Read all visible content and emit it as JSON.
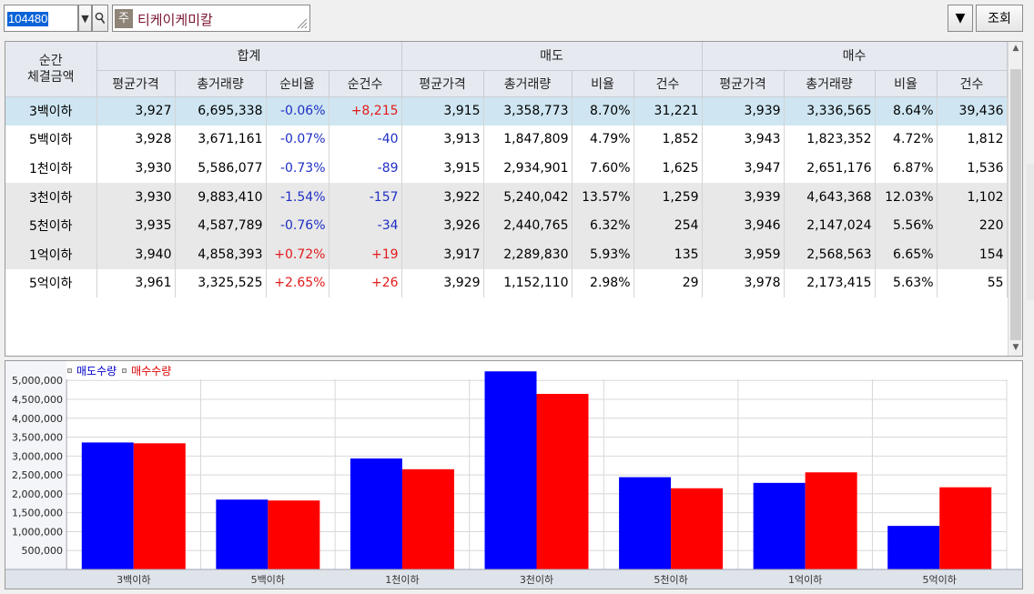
{
  "toolbar": {
    "code": "104480",
    "market_badge": "주",
    "stock_name": "티케이케미칼",
    "query_label": "조회"
  },
  "table": {
    "header_first": "순간\n체결금액",
    "groups": [
      "합계",
      "매도",
      "매수"
    ],
    "sub_headers": [
      "평균가격",
      "총거래량",
      "순비율",
      "순건수",
      "평균가격",
      "총거래량",
      "비율",
      "건수",
      "평균가격",
      "총거래량",
      "비율",
      "건수"
    ],
    "rows": [
      {
        "label": "3백이하",
        "cells": [
          "3,927",
          "6,695,338",
          "-0.06%",
          "+8,215",
          "3,915",
          "3,358,773",
          "8.70%",
          "31,221",
          "3,939",
          "3,336,565",
          "8.64%",
          "39,436"
        ]
      },
      {
        "label": "5백이하",
        "cells": [
          "3,928",
          "3,671,161",
          "-0.07%",
          "-40",
          "3,913",
          "1,847,809",
          "4.79%",
          "1,852",
          "3,943",
          "1,823,352",
          "4.72%",
          "1,812"
        ]
      },
      {
        "label": "1천이하",
        "cells": [
          "3,930",
          "5,586,077",
          "-0.73%",
          "-89",
          "3,915",
          "2,934,901",
          "7.60%",
          "1,625",
          "3,947",
          "2,651,176",
          "6.87%",
          "1,536"
        ]
      },
      {
        "label": "3천이하",
        "cells": [
          "3,930",
          "9,883,410",
          "-1.54%",
          "-157",
          "3,922",
          "5,240,042",
          "13.57%",
          "1,259",
          "3,939",
          "4,643,368",
          "12.03%",
          "1,102"
        ]
      },
      {
        "label": "5천이하",
        "cells": [
          "3,935",
          "4,587,789",
          "-0.76%",
          "-34",
          "3,926",
          "2,440,765",
          "6.32%",
          "254",
          "3,946",
          "2,147,024",
          "5.56%",
          "220"
        ]
      },
      {
        "label": "1억이하",
        "cells": [
          "3,940",
          "4,858,393",
          "+0.72%",
          "+19",
          "3,917",
          "2,289,830",
          "5.93%",
          "135",
          "3,959",
          "2,568,563",
          "6.65%",
          "154"
        ]
      },
      {
        "label": "5억이하",
        "cells": [
          "3,961",
          "3,325,525",
          "+2.65%",
          "+26",
          "3,929",
          "1,152,110",
          "2.98%",
          "29",
          "3,978",
          "2,173,415",
          "5.63%",
          "55"
        ]
      }
    ]
  },
  "colors": {
    "sell": "#0000ff",
    "buy": "#ff0000",
    "negative_text": "#1f2fc4",
    "positive_text": "#e21a1a",
    "highlight_row": "#cfe6f2"
  },
  "chart_data": {
    "type": "bar",
    "categories": [
      "3백이하",
      "5백이하",
      "1천이하",
      "3천이하",
      "5천이하",
      "1억이하",
      "5억이하"
    ],
    "series": [
      {
        "name": "매도수량",
        "color": "#0000ff",
        "values": [
          3358773,
          1847809,
          2934901,
          5240042,
          2440765,
          2289830,
          1152110
        ]
      },
      {
        "name": "매수수량",
        "color": "#ff0000",
        "values": [
          3336565,
          1823352,
          2651176,
          4643368,
          2147024,
          2568563,
          2173415
        ]
      }
    ],
    "yticks": [
      "500,000",
      "1,000,000",
      "1,500,000",
      "2,000,000",
      "2,500,000",
      "3,000,000",
      "3,500,000",
      "4,000,000",
      "4,500,000",
      "5,000,000"
    ],
    "ylim": [
      0,
      5000000
    ],
    "grid": true,
    "legend_position": "top-left"
  }
}
